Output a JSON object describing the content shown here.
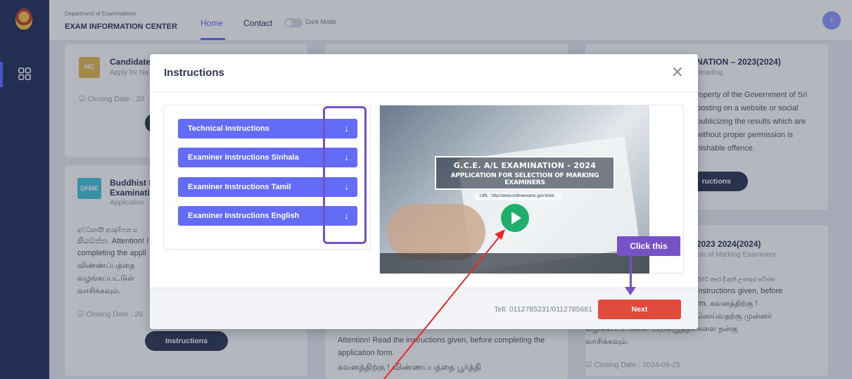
{
  "header": {
    "department": "Department of Examinations",
    "center_title": "EXAM INFORMATION CENTER",
    "nav_home": "Home",
    "nav_contact": "Contact",
    "dark_mode_label": "Dark Mode",
    "avatar_glyph": "♀"
  },
  "colors": {
    "sidebar": "#1f2d5a",
    "accent": "#5b6cff",
    "instruction_button": "#636bf7",
    "next_button": "#e04b3d",
    "callout": "#7652c7",
    "annotation_arrow": "#e8282b"
  },
  "cards": {
    "left_top": {
      "badge": "NC",
      "title": "Candidate",
      "subtitle": "Apply for Na",
      "closing": "☑ Closing Date : 20"
    },
    "left_bottom": {
      "badge": "DFME",
      "title_line1": "Buddhist D",
      "title_line2": "Examinati",
      "subtitle": "Application",
      "text_line1": "අවධානයි! අයදුම්පත ස",
      "text_line2": "කියවන්න. Attention! I",
      "text_line3": "completing the appli",
      "text_line4": "விண்ணப்பத்தை",
      "text_line5": "வழங்கப்பட்டுள்",
      "text_line6": "வாசிக்கவும்.",
      "closing": "☑ Closing Date : 20",
      "button": "Instructions"
    },
    "middle_bottom": {
      "text_line1": "Attention! Read the instructions given, before completing the",
      "text_line2": "application form.",
      "text_line3": "கவனத்திற்கு ! விண்ணப்பத்தை பூர்த்தி"
    },
    "right_top": {
      "title": "NATION – 2023(2024)",
      "subtitle": "nloading",
      "text_line1": "roperty of the Government of Sri",
      "text_line2": "posting on a website or social",
      "text_line3": "publicizing the results which are",
      "text_line4": "without proper permission is",
      "text_line5": "nishable offence.",
      "button": "ructions"
    },
    "right_bottom": {
      "title": "2023 2024(2024)",
      "subtitle": "ion of Marking Examiners",
      "text_line1": "යිමට පෙර දී ඇති උපදෙස් සවිස්ත",
      "text_line2": "instructions given, before",
      "text_line3": "rm. கவனத்திற்கு !",
      "text_line4": "ஸெய்வதற்கு முன்னர்",
      "text_line5": "வழங்கப்பட்டுள்ள அறிவுறுத்தல்களை நன்கு",
      "text_line6": "வாசிக்கவும்.",
      "closing": "☑ Closing Date : 2024-09-25"
    }
  },
  "modal": {
    "title": "Instructions",
    "close_glyph": "✕",
    "instructions": [
      {
        "label": "Technical Instructions",
        "arrow": "↓"
      },
      {
        "label": "Examiner Instructions Sinhala",
        "arrow": "↓"
      },
      {
        "label": "Examiner Instructions Tamil",
        "arrow": "↓"
      },
      {
        "label": "Examiner Instructions English",
        "arrow": "↓"
      }
    ],
    "video": {
      "banner_line1": "G.C.E. A/L EXAMINATION - 2024",
      "banner_line2": "APPLICATION FOR SELECTION OF MARKING EXAMINERS",
      "url": "URL : http://www.onlineexams.gov.lk/eic"
    },
    "tel": "Tell: 0112785231/0112785681",
    "next_label": "Next"
  },
  "annotations": {
    "callout_label": "Click this"
  }
}
